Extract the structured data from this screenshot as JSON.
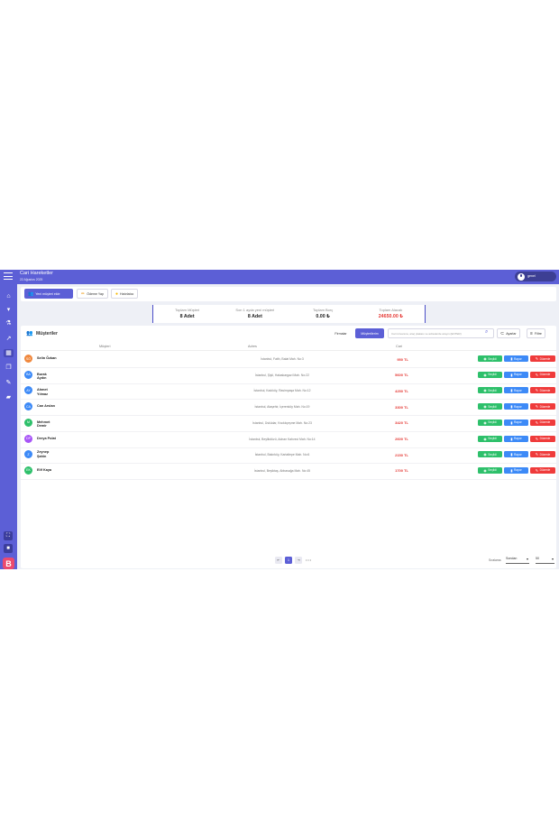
{
  "header": {
    "title": "Cari Hareketler",
    "date": "22 Ağustos 2025",
    "username": "genel"
  },
  "sidebar": {
    "icons": [
      "home-icon",
      "cart-icon",
      "flask-icon",
      "chart-icon",
      "building-icon",
      "files-icon",
      "wrench-icon",
      "truck-icon"
    ],
    "brand_letter": "B"
  },
  "toolbar": {
    "buttons": [
      {
        "label": "Yeni müşteri ekle",
        "icon": "user-plus-icon"
      },
      {
        "label": "Ödeme Yap",
        "icon": "pencil-icon"
      },
      {
        "label": "Hatırlatıcı",
        "icon": "bell-icon"
      }
    ]
  },
  "stats": [
    {
      "label": "Toplam Müşteri",
      "value": "8 Adet"
    },
    {
      "label": "Son 1 ayda yeni müşteri",
      "value": "8 Adet"
    },
    {
      "label": "Toplam Borç",
      "value": "0.00 ₺"
    },
    {
      "label": "Toplam Alacak",
      "value": "24650.00 ₺"
    }
  ],
  "panel": {
    "title": "Müşteriler",
    "tabs": [
      "Firmalar",
      "Müşterilerim"
    ],
    "search_placeholder": "Cari ünvanına, araç plakası ve adreslerde arayın (ENTER)",
    "filter_buttons": [
      "Ayarlar",
      "Filtre"
    ],
    "columns": [
      "Müşteri",
      "Adres",
      "Cari"
    ]
  },
  "customers": [
    {
      "initials": "SÖ",
      "name": "Selin Özkan",
      "address": "İstanbul, Fatih, Balat Mah. No:3",
      "balance": "950 TL",
      "color": "#f0883e"
    },
    {
      "initials": "BA",
      "name": "Burak Aydın",
      "address": "İstanbul, Şişli, Halaskargazi Mah. No:22",
      "balance": "5600 TL",
      "color": "#3d8af7"
    },
    {
      "initials": "AY",
      "name": "Ahmet Yılmaz",
      "address": "İstanbul, Kadıköy, Rasimpaşa Mah. No:12",
      "balance": "4250 TL",
      "color": "#3d8af7"
    },
    {
      "initials": "CA",
      "name": "Can Arslan",
      "address": "İstanbul, Ataşehir, İçerenköy Mah. No:19",
      "balance": "3300 TL",
      "color": "#3d8af7"
    },
    {
      "initials": "M",
      "name": "Mehmet Demir",
      "address": "İstanbul, Üsküdar, Kısıklıçeşme Mah. No:23",
      "balance": "3420 TL",
      "color": "#2ec06b"
    },
    {
      "initials": "DP",
      "name": "Derya Polat",
      "address": "İstanbul, Beylikdüzü, Adnan Kahveci Mah. No:14",
      "balance": "2600 TL",
      "color": "#a855f7"
    },
    {
      "initials": "Z",
      "name": "Zeynep Şahin",
      "address": "İstanbul, Bakırköy, Kartaltepe Mah. No:6",
      "balance": "2150 TL",
      "color": "#3d8af7"
    },
    {
      "initials": "EK",
      "name": "Elif Kaya",
      "address": "İstanbul, Beşiktaş, Abbasağa Mah. No:45",
      "balance": "1700 TL",
      "color": "#2ec06b"
    }
  ],
  "row_actions": [
    "Seçildi",
    "Rapor",
    "Düzenle"
  ],
  "pagination": {
    "current": "1",
    "prev": "⇤",
    "next": "⇥",
    "more": "• • •"
  },
  "footer": {
    "sort_label": "Sıralama",
    "sort_value": "Sondan",
    "page_size": "50"
  }
}
